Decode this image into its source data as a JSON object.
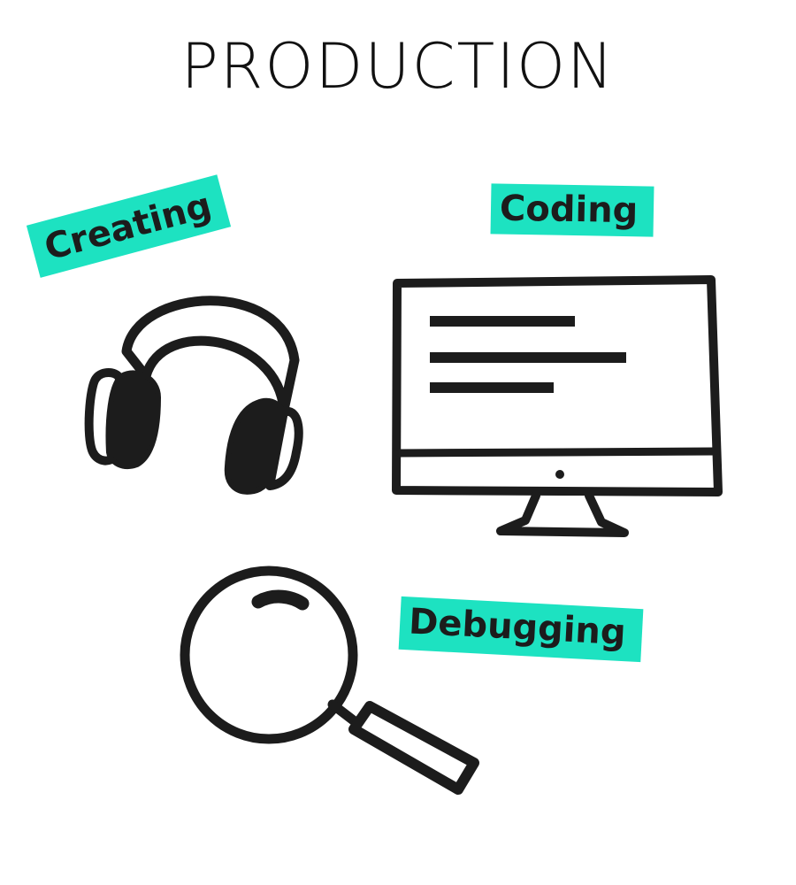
{
  "title": "PRODUCTION",
  "accent_color": "#1de2c1",
  "ink_color": "#1c1c1c",
  "items": [
    {
      "label": "Creating",
      "icon": "headphones-icon"
    },
    {
      "label": "Coding",
      "icon": "monitor-icon"
    },
    {
      "label": "Debugging",
      "icon": "magnifying-glass-icon"
    }
  ]
}
